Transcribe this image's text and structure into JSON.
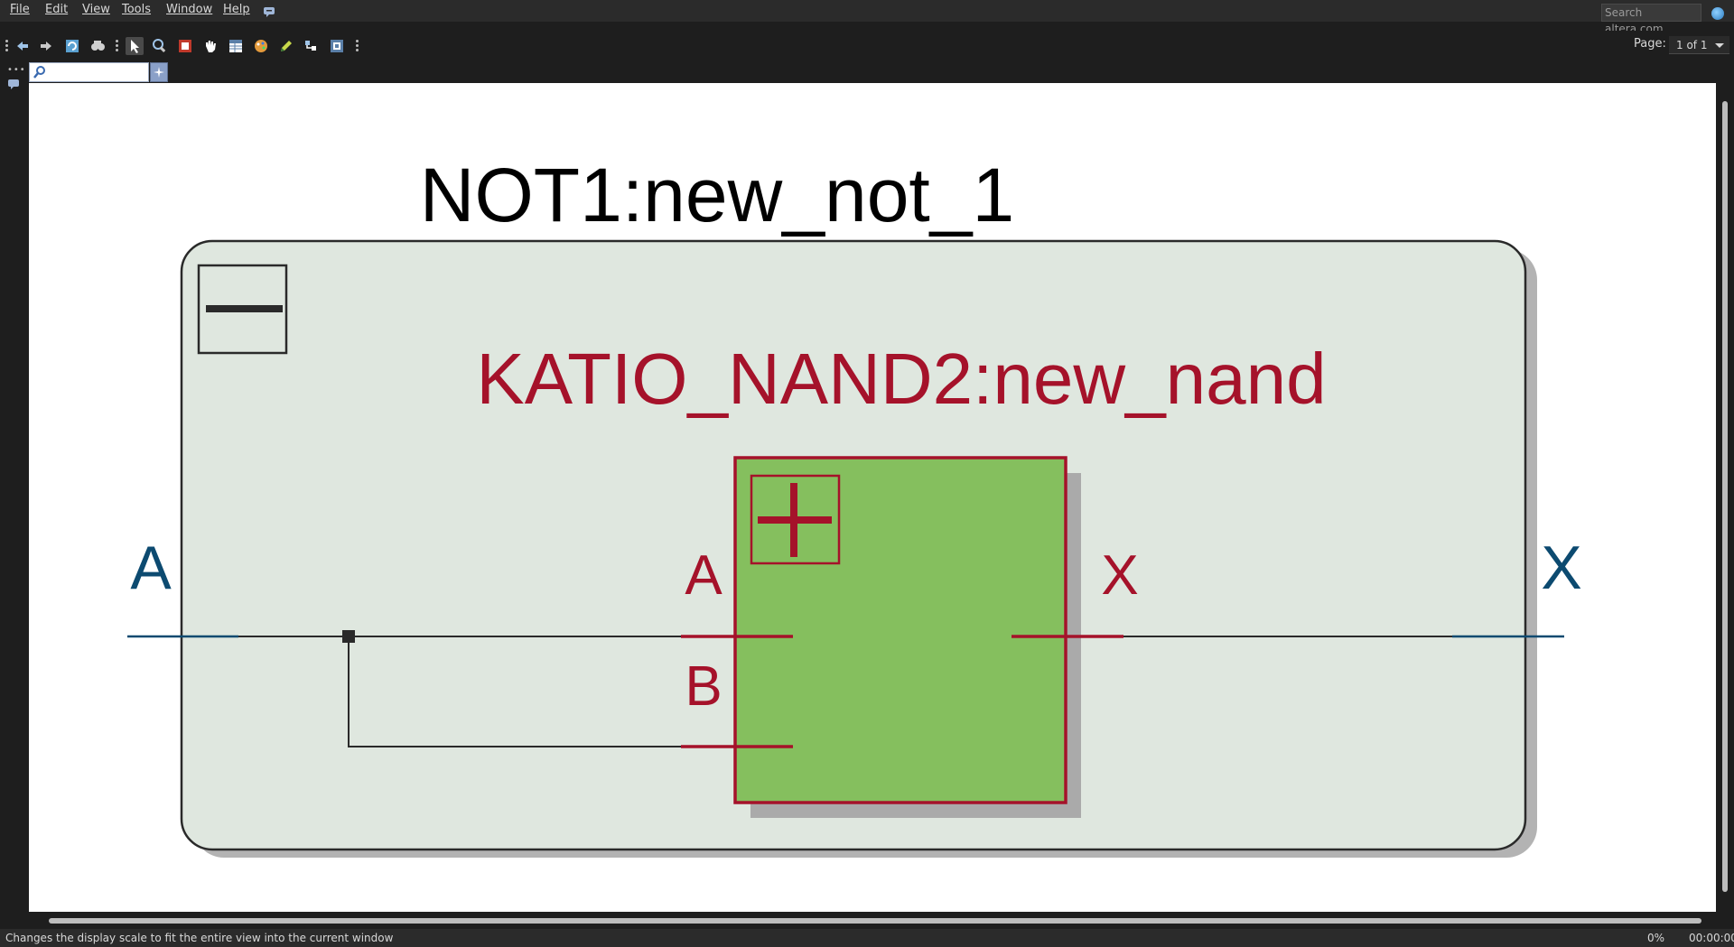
{
  "menubar": {
    "items": [
      {
        "label": "File"
      },
      {
        "label": "Edit"
      },
      {
        "label": "View"
      },
      {
        "label": "Tools"
      },
      {
        "label": "Window"
      },
      {
        "label": "Help"
      }
    ],
    "search_placeholder": "Search altera.com"
  },
  "toolbar": {
    "page_label": "Page:",
    "page_value": "1 of 1"
  },
  "schematic": {
    "outer_instance": "NOT1:new_not_1",
    "inner_instance": "KATIO_NAND2:new_nand",
    "inner_ports": {
      "a": "A",
      "b": "B",
      "x": "X"
    },
    "top_ports": {
      "input": "A",
      "output": "X"
    },
    "colors": {
      "outer_fill": "#dfe7df",
      "inner_fill": "#85bf5e",
      "inner_stroke": "#a5122a",
      "port_blue": "#0c4a70"
    }
  },
  "status": {
    "message": "Changes the display scale to fit the entire view into the current window",
    "progress": "0%",
    "time": "00:00:00"
  }
}
